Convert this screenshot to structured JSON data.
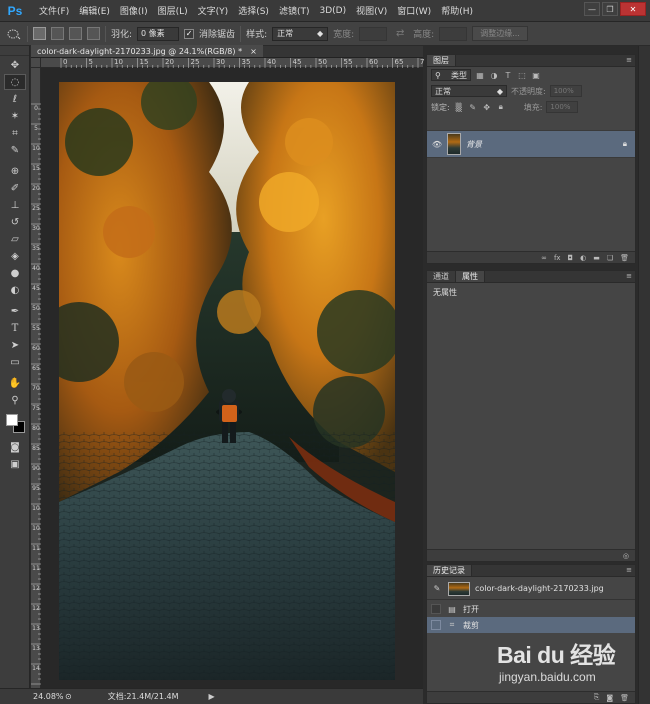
{
  "app": {
    "logo": "Ps"
  },
  "menu": [
    "文件(F)",
    "编辑(E)",
    "图像(I)",
    "图层(L)",
    "文字(Y)",
    "选择(S)",
    "滤镜(T)",
    "3D(D)",
    "视图(V)",
    "窗口(W)",
    "帮助(H)"
  ],
  "window_controls": {
    "minimize": "—",
    "restore": "❐",
    "close": "✕"
  },
  "options": {
    "feather_label": "羽化:",
    "feather_value": "0 像素",
    "antialias_label": "消除锯齿",
    "antialias_checked": "✓",
    "style_label": "样式:",
    "style_value": "正常",
    "width_label": "宽度:",
    "height_label": "高度:",
    "refine_edge": "调整边缘..."
  },
  "document": {
    "tab_title": "color-dark-daylight-2170233.jpg @ 24.1%(RGB/8) *",
    "tab_close": "×",
    "ruler_top": [
      "0",
      "5",
      "10",
      "15",
      "20",
      "25",
      "30",
      "35",
      "40",
      "45",
      "50",
      "55",
      "60",
      "65",
      "70"
    ],
    "ruler_left": [
      "0",
      "5",
      "1 0",
      "1 5",
      "2 0",
      "2 5",
      "3 0",
      "3 5",
      "4 0",
      "4 5",
      "5 0",
      "5 5",
      "6 0",
      "6 5",
      "7 0",
      "7 5",
      "8 0",
      "8 5",
      "9 0",
      "9 5",
      "1 0 0",
      "1 0 5",
      "1 1 0",
      "1 1 5",
      "1 2 0",
      "1 2 5",
      "1 3 0",
      "1 3 5",
      "1 4 0",
      "1 4 5",
      "1 5 0"
    ]
  },
  "status": {
    "zoom": "24.08%",
    "doc_size": "文档:21.4M/21.4M",
    "arrow": "▶"
  },
  "layers_panel": {
    "tab": "图层",
    "filter_kind": "类型",
    "blend_mode": "正常",
    "opacity_label": "不透明度:",
    "opacity_value": "100%",
    "lock_label": "锁定:",
    "fill_label": "填充:",
    "fill_value": "100%",
    "layers": [
      {
        "name": "背景",
        "locked": true
      }
    ]
  },
  "properties_panel": {
    "tabs": [
      "通道",
      "属性"
    ],
    "active_tab": "属性",
    "content": "无属性"
  },
  "history_panel": {
    "tab": "历史记录",
    "snapshot": "color-dark-daylight-2170233.jpg",
    "items": [
      {
        "label": "打开",
        "selected": false
      },
      {
        "label": "裁剪",
        "selected": true
      }
    ]
  },
  "watermark": {
    "brand": "Bai du 经验",
    "url": "jingyan.baidu.com"
  },
  "colors": {
    "accent": "#31a8ff",
    "selection": "#5b6a7e",
    "panel": "#454545",
    "chrome": "#3a3a3a",
    "close": "#bb3333"
  }
}
